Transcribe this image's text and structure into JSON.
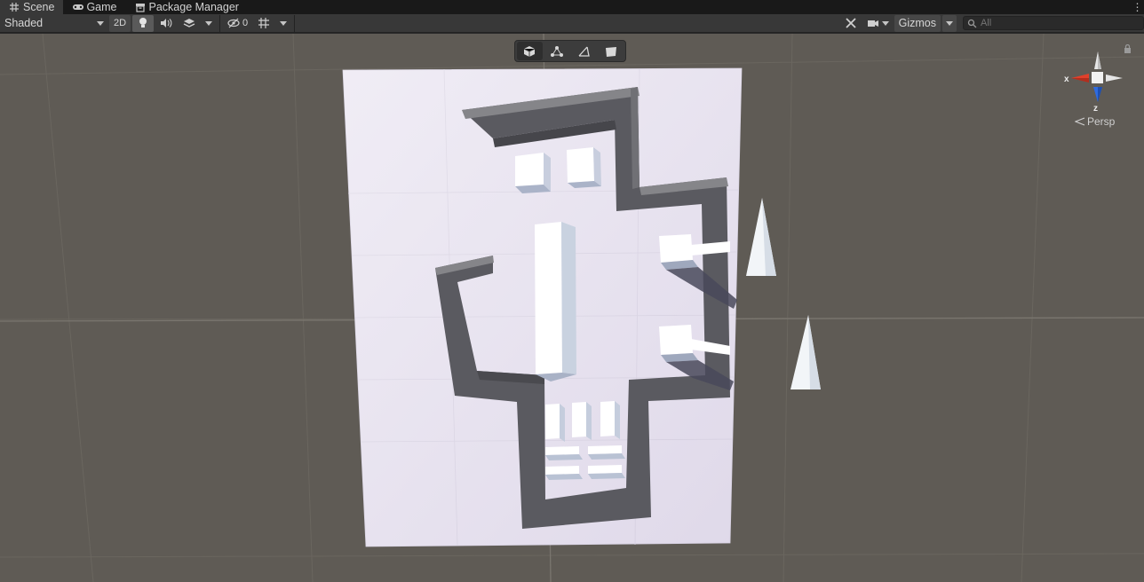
{
  "tabs": [
    {
      "label": "Scene",
      "icon": "grid-icon",
      "active": true
    },
    {
      "label": "Game",
      "icon": "gamepad-icon",
      "active": false
    },
    {
      "label": "Package Manager",
      "icon": "package-icon",
      "active": false
    }
  ],
  "toolbar": {
    "draw_mode": "Shaded",
    "two_d_label": "2D",
    "hidden_count": "0",
    "gizmos_label": "Gizmos",
    "search_placeholder": "All"
  },
  "overlay_tools": [
    "cube-icon",
    "vertex-icon",
    "edge-icon",
    "face-icon"
  ],
  "orientation_gizmo": {
    "x_label": "x",
    "z_label": "z",
    "projection_label": "Persp"
  },
  "colors": {
    "viewport_bg": "#5f5b55",
    "plane": "#e6e1ee",
    "wall": "#5e5e63",
    "x_axis": "#e0402b",
    "z_axis": "#2e6be0"
  }
}
